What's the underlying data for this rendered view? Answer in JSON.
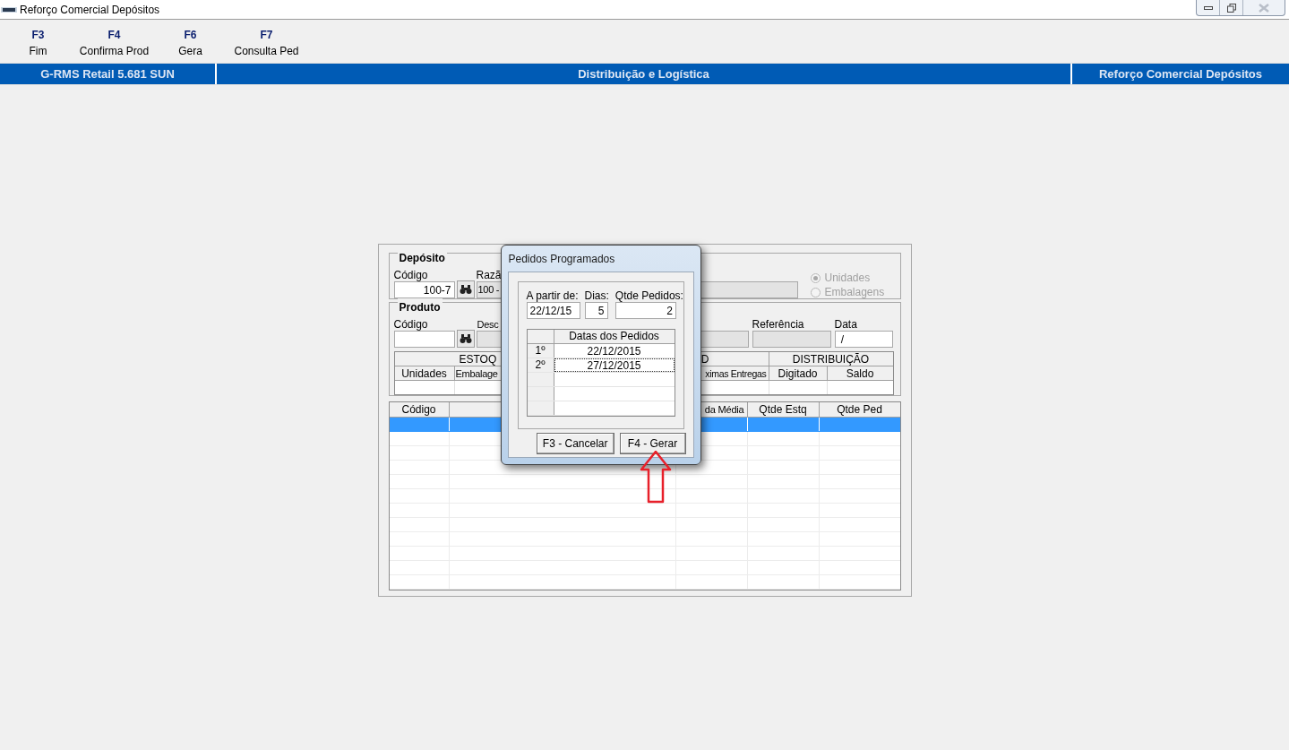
{
  "window": {
    "title": "Reforço Comercial Depósitos"
  },
  "toolbar": [
    {
      "key": "F3",
      "label": "Fim"
    },
    {
      "key": "F4",
      "label": "Confirma Prod"
    },
    {
      "key": "F6",
      "label": "Gera"
    },
    {
      "key": "F7",
      "label": "Consulta Ped"
    }
  ],
  "header_bar": [
    "G-RMS Retail 5.681 SUN",
    "Distribuição e Logística",
    "Reforço Comercial Depósitos"
  ],
  "deposito": {
    "legend": "Depósito",
    "code_label": "Código",
    "code_value": "100-7",
    "name_label": "Razã",
    "name_value": "100 -",
    "units": [
      {
        "label": "Unidades",
        "selected": true,
        "disabled": true
      },
      {
        "label": "Embalagens",
        "selected": false,
        "disabled": true
      }
    ]
  },
  "produto": {
    "legend": "Produto",
    "code_label": "Código",
    "description_label": "Desc",
    "reference_label": "Referência",
    "date_label": "Data",
    "date_value": " / "
  },
  "stock_grid": {
    "groups": [
      "ESTOQ",
      "D",
      "DISTRIBUIÇÃO"
    ],
    "columns": [
      "Unidades",
      "Embalage",
      "ximas Entregas",
      "Digitado",
      "Saldo"
    ]
  },
  "items_table": {
    "columns": [
      "Código",
      "da Média",
      "Qtde Estq",
      "Qtde Ped"
    ],
    "rows": [
      {
        "selected": true
      },
      {
        "selected": false
      },
      {
        "selected": false
      },
      {
        "selected": false
      },
      {
        "selected": false
      },
      {
        "selected": false
      },
      {
        "selected": false
      },
      {
        "selected": false
      },
      {
        "selected": false
      },
      {
        "selected": false
      },
      {
        "selected": false
      },
      {
        "selected": false
      }
    ]
  },
  "dialog": {
    "title": "Pedidos Programados",
    "start_label": "A partir de:",
    "start_value": "22/12/15",
    "days_label": "Dias:",
    "days_value": "5",
    "count_label": "Qtde Pedidos:",
    "count_value": "2",
    "dates_header": "Datas dos Pedidos",
    "dates": [
      {
        "index": "1º",
        "date": "22/12/2015",
        "selected": false
      },
      {
        "index": "2º",
        "date": "27/12/2015",
        "selected": true
      }
    ],
    "buttons": [
      "F3 - Cancelar",
      "F4 - Gerar"
    ]
  }
}
